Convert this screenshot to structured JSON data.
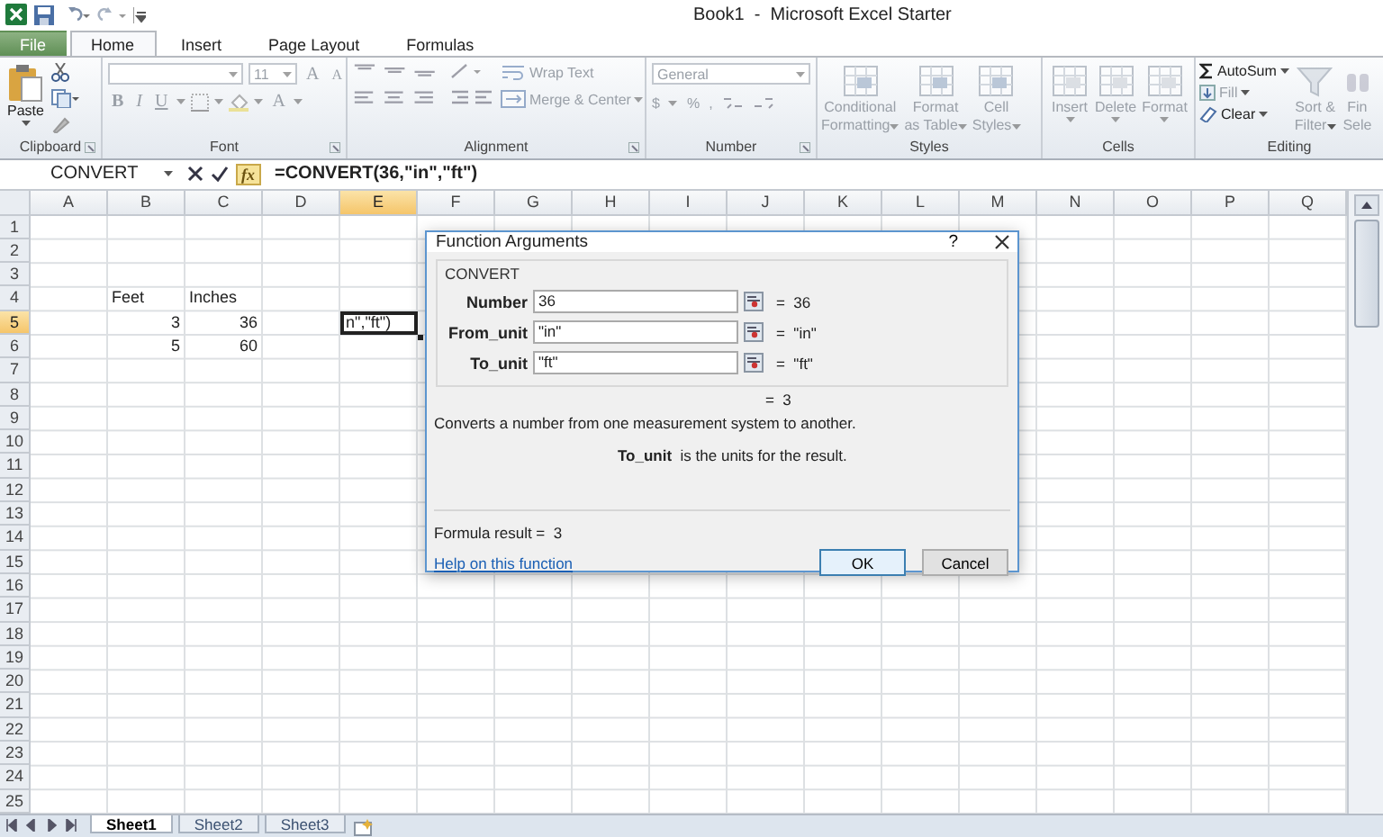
{
  "window": {
    "title": "Book1  -  Microsoft Excel Starter"
  },
  "tabs": [
    {
      "label": "File",
      "kind": "file",
      "selected": false
    },
    {
      "label": "Home",
      "kind": "tab",
      "selected": true
    },
    {
      "label": "Insert",
      "kind": "tab",
      "selected": false
    },
    {
      "label": "Page Layout",
      "kind": "tab",
      "selected": false
    },
    {
      "label": "Formulas",
      "kind": "tab",
      "selected": false
    }
  ],
  "ribbon": {
    "clipboard": {
      "label": "Clipboard",
      "paste": "Paste",
      "disabled": false
    },
    "font": {
      "label": "Font",
      "size": "11",
      "grow": "A",
      "shrink": "A",
      "bold": "B",
      "italic": "I",
      "underline": "U",
      "font_color": "A",
      "disabled": true
    },
    "alignment": {
      "label": "Alignment",
      "wrap": "Wrap Text",
      "merge": "Merge & Center",
      "disabled": true
    },
    "number": {
      "label": "Number",
      "format": "General",
      "currency": "$",
      "percent": "%",
      "comma": ",",
      "disabled": true
    },
    "styles": {
      "label": "Styles",
      "disabled": true,
      "buttons": [
        {
          "lines": [
            "Conditional",
            "Formatting"
          ]
        },
        {
          "lines": [
            "Format",
            "as Table"
          ]
        },
        {
          "lines": [
            "Cell",
            "Styles"
          ]
        }
      ]
    },
    "cells": {
      "label": "Cells",
      "disabled": true,
      "buttons": [
        {
          "lines": [
            "Insert"
          ]
        },
        {
          "lines": [
            "Delete"
          ]
        },
        {
          "lines": [
            "Format"
          ]
        }
      ]
    },
    "editing": {
      "label": "Editing",
      "autosum": {
        "label": "AutoSum",
        "disabled": false
      },
      "fill": {
        "label": "Fill",
        "disabled": true
      },
      "clear": {
        "label": "Clear",
        "disabled": false
      },
      "sort": {
        "lines": [
          "Sort &",
          "Filter"
        ],
        "disabled": true
      },
      "find": {
        "lines": [
          "Fin",
          "Sele"
        ],
        "disabled": true
      }
    }
  },
  "formula_bar": {
    "name_box": "CONVERT",
    "fx": "fx",
    "formula": "=CONVERT(36,\"in\",\"ft\")"
  },
  "grid": {
    "columns": [
      {
        "label": "A",
        "selected": false
      },
      {
        "label": "B",
        "selected": false
      },
      {
        "label": "C",
        "selected": false
      },
      {
        "label": "D",
        "selected": false
      },
      {
        "label": "E",
        "selected": true
      },
      {
        "label": "F",
        "selected": false
      },
      {
        "label": "G",
        "selected": false
      },
      {
        "label": "H",
        "selected": false
      },
      {
        "label": "I",
        "selected": false
      },
      {
        "label": "J",
        "selected": false
      },
      {
        "label": "K",
        "selected": false
      },
      {
        "label": "L",
        "selected": false
      },
      {
        "label": "M",
        "selected": false
      },
      {
        "label": "N",
        "selected": false
      },
      {
        "label": "O",
        "selected": false
      },
      {
        "label": "P",
        "selected": false
      },
      {
        "label": "Q",
        "selected": false
      }
    ],
    "rows": [
      {
        "label": "1",
        "selected": false
      },
      {
        "label": "2",
        "selected": false
      },
      {
        "label": "3",
        "selected": false
      },
      {
        "label": "4",
        "selected": false,
        "cells": [
          {},
          {
            "text": "Feet",
            "kind": "text"
          },
          {
            "text": "Inches",
            "kind": "text"
          }
        ]
      },
      {
        "label": "5",
        "selected": true,
        "cells": [
          {},
          {
            "text": "3",
            "kind": "number"
          },
          {
            "text": "36",
            "kind": "number"
          },
          {},
          {
            "text": "n\",\"ft\")",
            "kind": "active"
          }
        ]
      },
      {
        "label": "6",
        "selected": false,
        "cells": [
          {},
          {
            "text": "5",
            "kind": "number"
          },
          {
            "text": "60",
            "kind": "number"
          }
        ]
      },
      {
        "label": "7",
        "selected": false
      },
      {
        "label": "8",
        "selected": false
      },
      {
        "label": "9",
        "selected": false
      },
      {
        "label": "10",
        "selected": false
      },
      {
        "label": "11",
        "selected": false
      },
      {
        "label": "12",
        "selected": false
      },
      {
        "label": "13",
        "selected": false
      },
      {
        "label": "14",
        "selected": false
      },
      {
        "label": "15",
        "selected": false
      },
      {
        "label": "16",
        "selected": false
      },
      {
        "label": "17",
        "selected": false
      },
      {
        "label": "18",
        "selected": false
      },
      {
        "label": "19",
        "selected": false
      },
      {
        "label": "20",
        "selected": false
      },
      {
        "label": "21",
        "selected": false
      },
      {
        "label": "22",
        "selected": false
      },
      {
        "label": "23",
        "selected": false
      },
      {
        "label": "24",
        "selected": false
      },
      {
        "label": "25",
        "selected": false
      }
    ]
  },
  "dialog": {
    "title": "Function Arguments",
    "help": "?",
    "function": "CONVERT",
    "args": [
      {
        "name": "Number",
        "value": "36",
        "result": "=  36"
      },
      {
        "name": "From_unit",
        "value": "\"in\"",
        "result": "=  \"in\""
      },
      {
        "name": "To_unit",
        "value": "\"ft\"",
        "result": "=  \"ft\""
      }
    ],
    "result": "=  3",
    "description": "Converts a number from one measurement system to another.",
    "arg_help": "**To_unit**  is the units for the result.",
    "formula_result": "Formula result =  3",
    "help_link": "Help on this function",
    "buttons": [
      {
        "label": "OK",
        "default": true
      },
      {
        "label": "Cancel",
        "default": false
      }
    ]
  },
  "sheets": [
    {
      "label": "Sheet1",
      "selected": true
    },
    {
      "label": "Sheet2",
      "selected": false
    },
    {
      "label": "Sheet3",
      "selected": false
    }
  ]
}
